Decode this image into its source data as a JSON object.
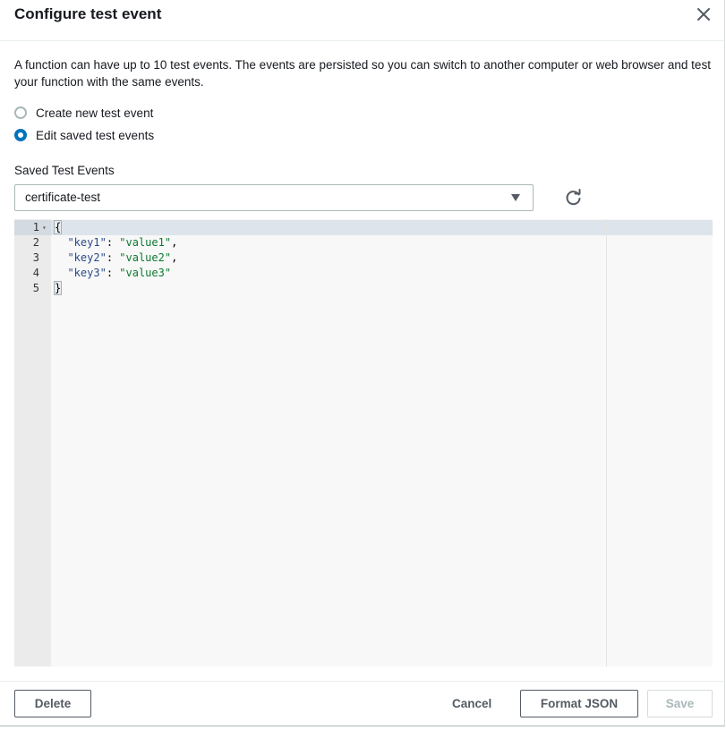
{
  "dialog": {
    "title": "Configure test event",
    "description": "A function can have up to 10 test events. The events are persisted so you can switch to another computer or web browser and test your function with the same events."
  },
  "radio_options": [
    {
      "label": "Create new test event",
      "checked": false
    },
    {
      "label": "Edit saved test events",
      "checked": true
    }
  ],
  "saved_events": {
    "label": "Saved Test Events",
    "selected": "certificate-test"
  },
  "editor": {
    "lines": [
      {
        "number": "1",
        "text": "{"
      },
      {
        "number": "2",
        "key": "\"key1\"",
        "value": "\"value1\"",
        "trailing": ","
      },
      {
        "number": "3",
        "key": "\"key2\"",
        "value": "\"value2\"",
        "trailing": ","
      },
      {
        "number": "4",
        "key": "\"key3\"",
        "value": "\"value3\"",
        "trailing": ""
      },
      {
        "number": "5",
        "text": "}"
      }
    ]
  },
  "footer": {
    "delete_label": "Delete",
    "cancel_label": "Cancel",
    "format_label": "Format JSON",
    "save_label": "Save"
  },
  "icons": {
    "close": "close-icon",
    "refresh": "refresh-icon",
    "caret": "caret-down-icon",
    "fold": "fold-arrow-icon"
  },
  "colors": {
    "accent": "#0073bb",
    "button_text": "#545b64",
    "disabled": "#aab7b8",
    "json_key": "#2a4a8a",
    "json_string": "#0b7a30"
  }
}
